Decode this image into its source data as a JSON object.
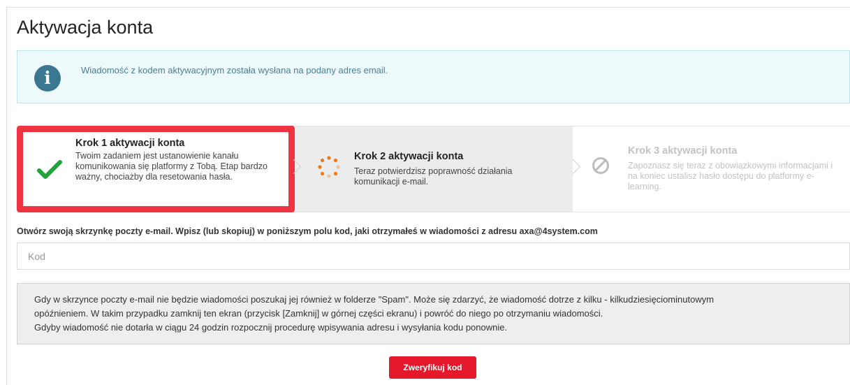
{
  "page": {
    "title": "Aktywacja konta"
  },
  "info": {
    "icon": "info-icon",
    "message": "Wiadomość z kodem aktywacyjnym została wysłana na podany adres email."
  },
  "steps": [
    {
      "title": "Krok 1 aktywacji konta",
      "description": "Twoim zadaniem jest ustanowienie kanału komunikowania się platformy z Tobą. Etap bardzo ważny, chociażby dla resetowania hasła.",
      "icon": "check-icon",
      "state": "done",
      "highlighted": true
    },
    {
      "title": "Krok 2 aktywacji konta",
      "description": "Teraz potwierdzisz poprawność działania komunikacji e-mail.",
      "icon": "spinner-icon",
      "state": "in-progress"
    },
    {
      "title": "Krok 3 aktywacji konta",
      "description": "Zapoznasz się teraz z obowiązkowymi informacjami i na koniec ustalisz hasło dostępu do platformy e-learning.",
      "icon": "ban-icon",
      "state": "disabled"
    }
  ],
  "form": {
    "instruction": "Otwórz swoją skrzynkę poczty e-mail. Wpisz (lub skopiuj) w poniższym polu kod, jaki otrzymałeś w wiadomości z adresu axa@4system.com",
    "code_placeholder": "Kod",
    "code_value": ""
  },
  "note": {
    "line1": "Gdy w skrzynce poczty e-mail nie będzie wiadomości poszukaj jej również w folderze \"Spam\". Może się zdarzyć, że wiadomość dotrze z kilku - kilkudziesięciominutowym",
    "line2": "opóźnieniem. W takim przypadku zamknij ten ekran (przycisk [Zamknij] w górnej części ekranu) i powróć do niego po otrzymaniu wiadomości.",
    "line3": "Gdyby wiadomość nie dotarła w ciągu 24 godzin rozpocznij procedurę wpisywania adresu i wysyłania kodu ponownie."
  },
  "actions": {
    "verify_label": "Zweryfikuj kod"
  },
  "colors": {
    "accent_red": "#e4182a",
    "check_green": "#1fa33a",
    "spinner_orange": "#f07a1a",
    "info_blue": "#3a7791"
  }
}
